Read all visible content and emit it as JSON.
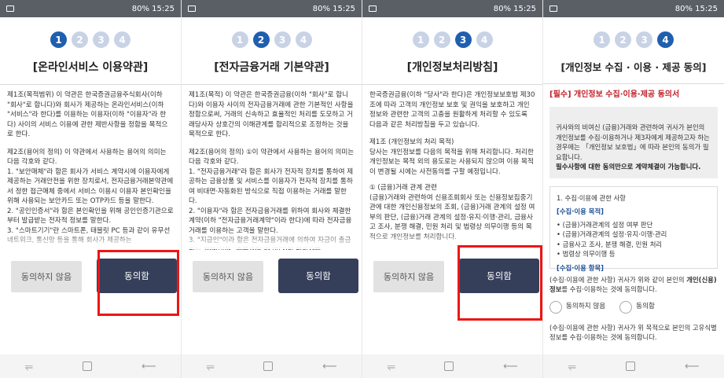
{
  "status": {
    "battery": "80%",
    "time": "15:25",
    "signal": " $ ☰ ⃝"
  },
  "icons": {
    "gallery": "image-icon",
    "nav_back": "back-arrow-icon",
    "nav_home": "home-square-icon",
    "nav_recent": "recent-apps-icon"
  },
  "colors": {
    "active_step": "#1f5fae",
    "inactive_step": "#c9d3e6",
    "agree_button": "#353f5a",
    "disagree_button": "#e2e2e2",
    "highlight": "#ee1515",
    "required_red": "#c0202a"
  },
  "steps": [
    "1",
    "2",
    "3",
    "4"
  ],
  "buttons": {
    "disagree": "동의하지 않음",
    "agree": "동의함"
  },
  "nav": {
    "recent": "⥫",
    "back": "⟵"
  },
  "screens": [
    {
      "title": "[온라인서비스 이용약관]",
      "paragraphs": [
        "제1조(목적범위) 이 약관은 한국증권금융주식회사(이하 \"회사\"로 합니다)와 회사가 제공하는 온라인서비스(이하 \"서비스\"라 한다)를 이용하는 이용자(이하 \"이용자\"라 한다) 사이의 서비스 이용에 관한 제반사항을 정함을 목적으로 한다.",
        "제2조(용어의 정의) 이 약관에서 사용하는 용어의 의미는 다음 각호와 같다.\n  1. \"보안매체\"라 함은 회사가 서비스 계약시에 이용자에게 제공하는 거래안전을 위한 장치로서, 전자금융거래본약관에서 정한 접근매체 중에서 서비스 이용시 이용자 본인확인을 위해 사용되는 보안카드 또는 OTP카드 등을 말한다.\n  2. \"공인인증서\"라 함은 본인확인을 위해 공인인증기관으로부터 발급받는 전자적 정보를 말한다.\n  3. \"스마트기기\"란 스마트폰, 태블릿 PC 등과 같이 유무선네트워크, 통신망 등을 통해 회사가 제공하는"
      ]
    },
    {
      "title": "[전자금융거래 기본약관]",
      "paragraphs": [
        "제1조(목적) 이 약관은 한국증권금융(이하 \"회사\"로 합니다)와 이용자 사이의 전자금융거래에 관한 기본적인 사항을 정함으로써, 거래의 신속하고 효율적인 처리를 도모하고 거래당사자 상호간의 이해관계를 합리적으로 조정하는 것을 목적으로 한다.",
        "제2조(용어의 정의) ①이 약관에서 사용하는 용어의 의미는 다음 각호와 같다.\n  1. \"전자금융거래\"라 함은 회사가 전자적 장치를 통하여 제공하는 금융상품 및 서비스를 이용자가 전자적 장치를 통하여 비대면·자동화된 방식으로 직접 이용하는 거래를 말한다.\n  2. \"이용자\"라 함은 전자금융거래를 위하여 회사와 체결한 계약(이하 \"전자금융거래계약\"이라 한다)에 따라 전자금융거래를 이용하는 고객을 말한다.\n  3. \"지급인\"이라 함은 전자금융거래에 의하여 자금이 출금되는 계좌(이하 \"출금계좌\"라 한다)의 명의자를"
      ]
    },
    {
      "title": "[개인정보처리방침]",
      "paragraphs": [
        "한국증권금융(이하 \"당사\"라 한다)은 개인정보보호법 제30조에 따라 고객의 개인정보 보호 및 권익을 보호하고 개인정보와 관련한 고객의 고충을 원활하게 처리할 수 있도록 다음과 같은 처리방침을 두고 있습니다.",
        "제1조 (개인정보의 처리 목적)\n당사는 개인정보를 다음의 목적을 위해 처리합니다. 처리한 개인정보는 목적 외의 용도로는 사용되지 않으며 이용 목적이 변경될 시에는 사전동의를 구할 예정입니다.",
        "① (금융)거래 관계 관련\n(금융)거래와 관련하여 신용조회회사 또는 신용정보집중기관에 대한 개인신용정보의 조회, (금융)거래 관계의 설정 여부의 판단, (금융)거래 관계의 설정·유지·이행·관리, 금융사고 조사, 분쟁 해결, 민원 처리 및 법령상 의무이행 등의 목적으로 개인정보를 처리합니다."
      ]
    },
    {
      "title": "[개인정보 수집 · 이용 · 제공 동의]",
      "required_title": "[필수] 개인정보 수집·이용·제공 동의서",
      "notice": "귀사와의 비여신 (금융)거래와 관련하여 귀사가 본인의 개인정보를 수집·이용하거나 제3자에게 제공하고자 하는 경우에는 「개인정보 보호법」에 따라 본인의 동의가 필요합니다.",
      "notice_bold": "필수사항에 대한 동의만으로 계약체결이 가능합니다.",
      "section_title": "1. 수집·이용에 관한 사항",
      "purpose_title": "[수집·이용 목적]",
      "purposes": [
        "(금융)거래관계의 설정 여부 판단",
        "(금융)거래관계의 설정·유지·이행·관리",
        "금융사고 조사, 분쟁 해결, 민원 처리",
        "법령상 의무이행 등"
      ],
      "items_title": "[수집·이용 항목]",
      "agree_text_pre": "(수집·이용에 관한 사항) 귀사가 위와 같이 본인의 ",
      "agree_text_bold": "개인(신용)정보",
      "agree_text_post": "를 수집·이용하는 것에 동의합니다.",
      "radio_disagree": "동의하지 않음",
      "radio_agree": "동의함",
      "bottom_text": "(수집·이용에 관한 사항) 귀사가 위 목적으로 본인의 고유식별정보를 수집·이용하는 것에 동의합니다."
    }
  ]
}
